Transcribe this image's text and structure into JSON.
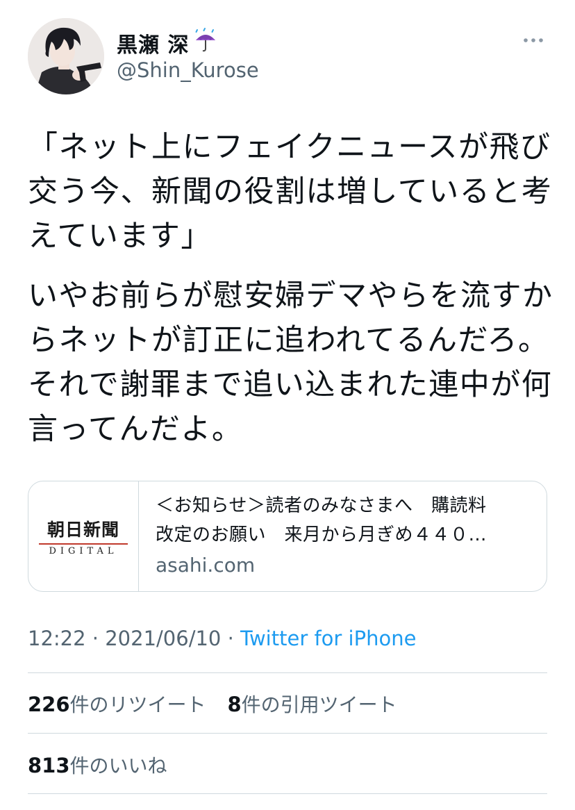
{
  "user": {
    "display_name": "黒瀬 深",
    "emoji_icon": "umbrella-with-rain-icon",
    "handle": "@Shin_Kurose"
  },
  "tweet": {
    "paragraph1": "「ネット上にフェイクニュースが飛び\n交う今、新聞の役割は増していると考\nえています」",
    "paragraph2": "いやお前らが慰安婦デマやらを流すか\nらネットが訂正に追われてるんだろ。\nそれで謝罪まで追い込まれた連中が何\n言ってんだよ。"
  },
  "card": {
    "logo_title": "朝日新聞",
    "logo_sub": "DIGITAL",
    "title": "＜お知らせ＞読者のみなさまへ　購読料\n改定のお願い　来月から月ぎめ４４０…",
    "domain": "asahi.com"
  },
  "meta": {
    "time": "12:22",
    "sep1": " · ",
    "date": "2021/06/10",
    "sep2": " · ",
    "source": "Twitter for iPhone"
  },
  "stats": {
    "retweets_count": "226",
    "retweets_label": "件のリツイート",
    "quotes_count": "8",
    "quotes_label": "件の引用ツイート",
    "likes_count": "813",
    "likes_label": "件のいいね"
  },
  "colors": {
    "text": "#0f1419",
    "secondary": "#536471",
    "link": "#1d9bf0",
    "border": "#cfd9de"
  }
}
